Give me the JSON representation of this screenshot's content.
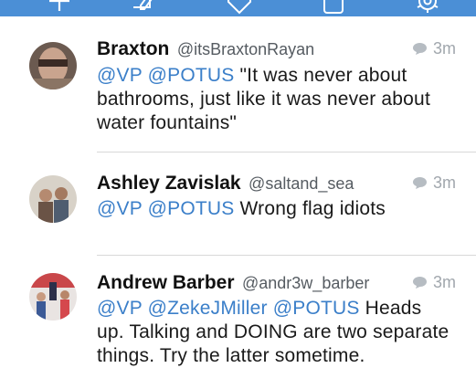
{
  "colors": {
    "topbar": "#4b8fd6",
    "mention": "#3b7fc9",
    "divider": "#d8d8d8"
  },
  "toolbar": {
    "icons": [
      "plus-icon",
      "compose-icon",
      "shield-icon",
      "copy-icon",
      "gear-icon"
    ]
  },
  "tweets": [
    {
      "name": "Braxton",
      "handle": "@itsBraxtonRayan",
      "time": "3m",
      "mentions": [
        "@VP",
        "@POTUS"
      ],
      "text": "\"It was never about bathrooms, just like it was never about water fountains\""
    },
    {
      "name": "Ashley Zavislak",
      "handle": "@saltand_sea",
      "time": "3m",
      "mentions": [
        "@VP",
        "@POTUS"
      ],
      "text": "Wrong flag idiots"
    },
    {
      "name": "Andrew Barber",
      "handle": "@andr3w_barber",
      "time": "3m",
      "mentions": [
        "@VP",
        "@ZekeJMiller",
        "@POTUS"
      ],
      "text": "Heads up. Talking and DOING are two separate things. Try the latter sometime."
    }
  ]
}
